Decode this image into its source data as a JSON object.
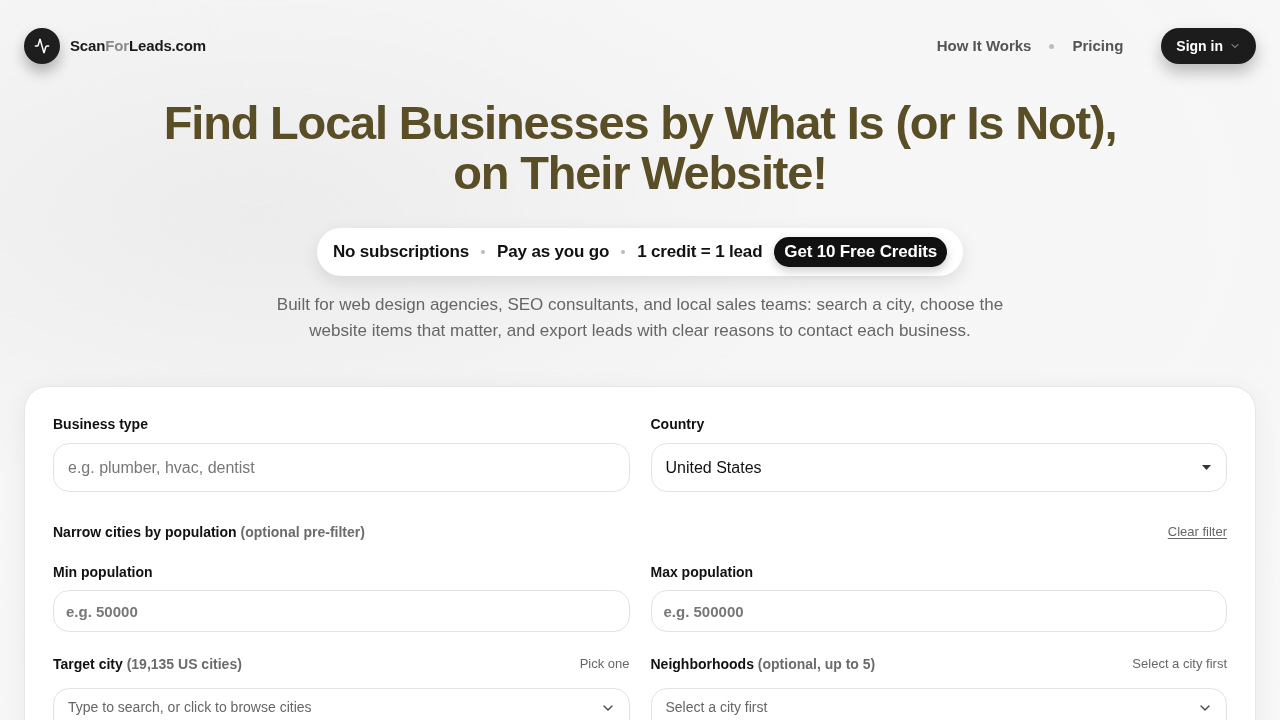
{
  "header": {
    "brand": [
      {
        "text": "Scan",
        "muted": false
      },
      {
        "text": "For",
        "muted": true
      },
      {
        "text": "Leads.com",
        "muted": false
      }
    ],
    "nav": [
      {
        "label": "How It Works"
      },
      {
        "label": "Pricing"
      }
    ],
    "sign_in": "Sign in"
  },
  "hero": {
    "title": "Find Local Businesses by What Is (or Is Not), on Their Website!",
    "perks": [
      "No subscriptions",
      "Pay as you go",
      "1 credit = 1 lead"
    ],
    "cta": "Get 10 Free Credits",
    "description": "Built for web design agencies, SEO consultants, and local sales teams: search a city, choose the website items that matter, and export leads with clear reasons to contact each business."
  },
  "form": {
    "business_type": {
      "label": "Business type",
      "placeholder": "e.g. plumber, hvac, dentist"
    },
    "country": {
      "label": "Country",
      "value": "United States"
    },
    "population_filter": {
      "label": "Narrow cities by population",
      "hint": "(optional pre-filter)",
      "clear": "Clear filter"
    },
    "min_population": {
      "label": "Min population",
      "placeholder": "e.g. 50000"
    },
    "max_population": {
      "label": "Max population",
      "placeholder": "e.g. 500000"
    },
    "target_city": {
      "label": "Target city",
      "hint": "(19,135 US cities)",
      "note": "Pick one",
      "placeholder": "Type to search, or click to browse cities"
    },
    "neighborhoods": {
      "label": "Neighborhoods",
      "hint": "(optional, up to 5)",
      "note": "Select a city first",
      "placeholder": "Select a city first"
    }
  }
}
